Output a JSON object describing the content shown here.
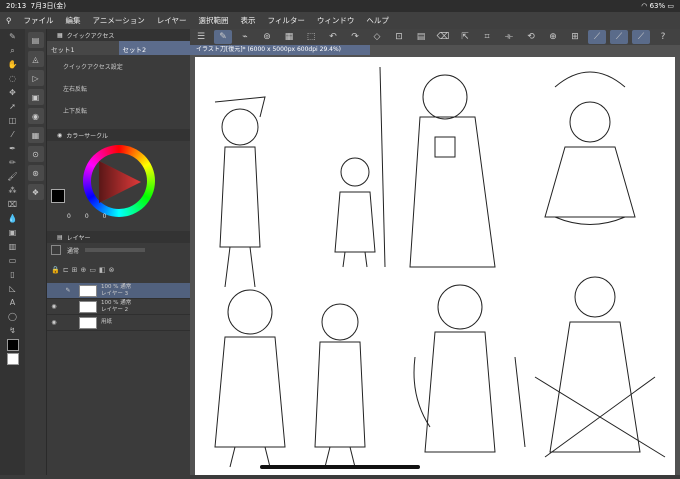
{
  "status": {
    "time": "20:13",
    "date": "7月3日(金)",
    "battery": "63%"
  },
  "menu": [
    "ファイル",
    "編集",
    "アニメーション",
    "レイヤー",
    "選択範囲",
    "表示",
    "フィルター",
    "ウィンドウ",
    "ヘルプ"
  ],
  "document_tab": "イラスト刀[復元]* (6000 x 5000px 600dpi 29.4%)",
  "quick_access": {
    "title": "クイックアクセス",
    "tabs": [
      "セット1",
      "セット2"
    ],
    "items": [
      "クイックアクセス設定",
      "左右反転",
      "上下反転"
    ]
  },
  "color_circle": {
    "title": "カラーサークル",
    "v1": "0",
    "v2": "0",
    "v3": "0",
    "accent": "#e13a3a"
  },
  "layer_panel": {
    "title": "レイヤー",
    "blend": "通常",
    "layers": [
      {
        "line1": "100 % 通常",
        "line2": "レイヤー 3",
        "selected": true
      },
      {
        "line1": "100 % 通常",
        "line2": "レイヤー 2",
        "selected": false
      },
      {
        "line1": "",
        "line2": "用紙",
        "selected": false
      }
    ]
  },
  "icons": [
    "search-icon",
    "gear-icon",
    "brush-icon",
    "undo-icon",
    "redo-icon",
    "eye-icon"
  ]
}
